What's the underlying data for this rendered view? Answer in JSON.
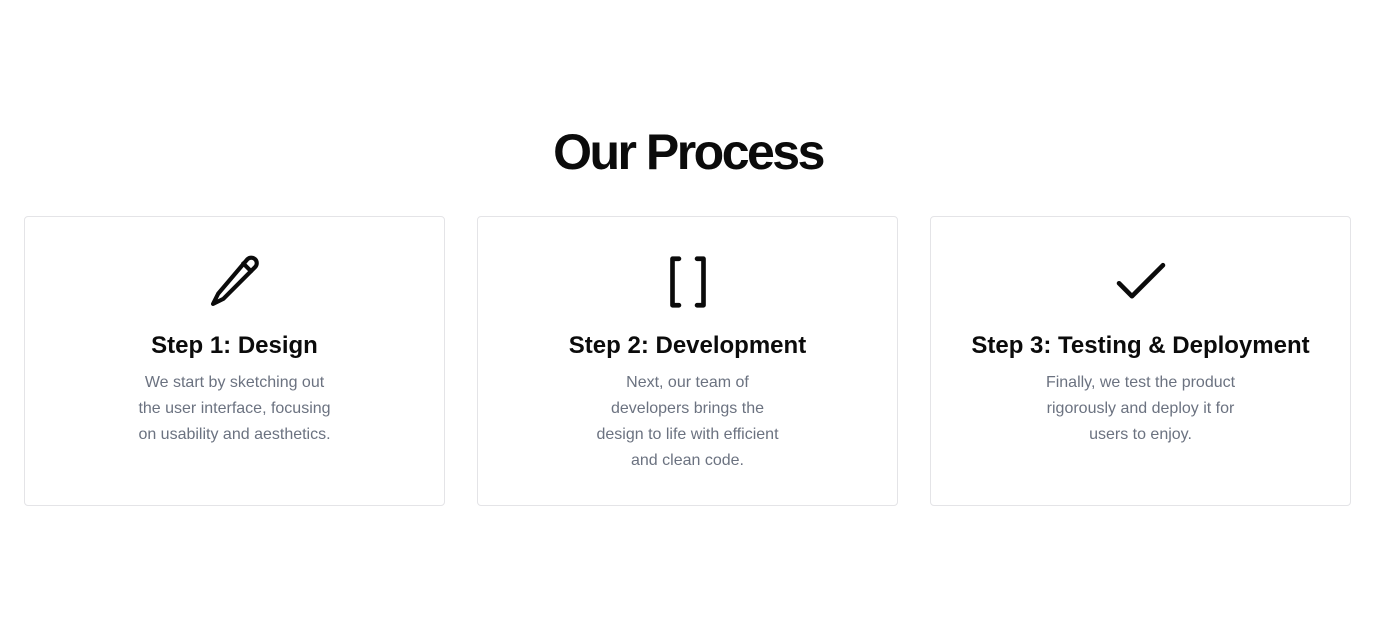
{
  "section": {
    "title": "Our Process"
  },
  "steps": [
    {
      "icon": "pencil-icon",
      "title": "Step 1: Design",
      "description": "We start by sketching out the user interface, focusing on usability and aesthetics."
    },
    {
      "icon": "brackets-icon",
      "title": "Step 2: Development",
      "description": "Next, our team of developers brings the design to life with efficient and clean code."
    },
    {
      "icon": "check-icon",
      "title": "Step 3: Testing & Deployment",
      "description": "Finally, we test the product rigorously and deploy it for users to enjoy."
    }
  ],
  "colors": {
    "heading": "#0b0b0b",
    "body_text": "#6b7280",
    "card_border": "#e4e4e7"
  }
}
